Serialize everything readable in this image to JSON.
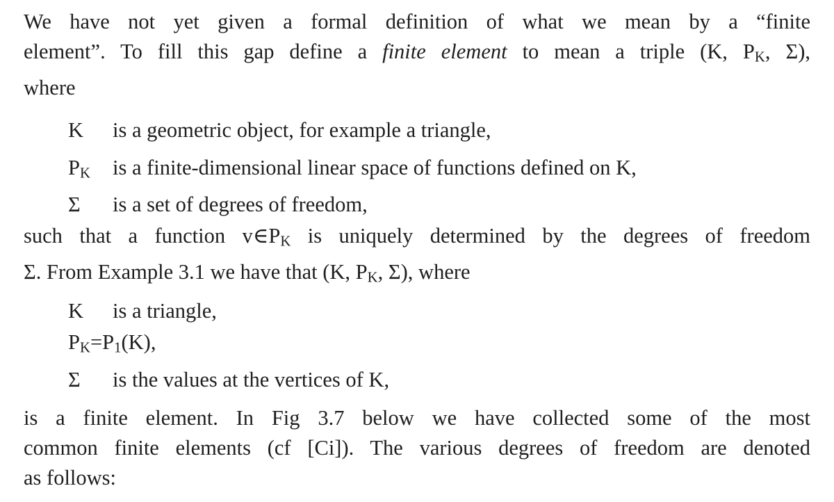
{
  "paragraph1": {
    "line1": "We have not yet given a formal definition of what we mean by a “finite",
    "line2_pre": "element”. To fill this gap define a ",
    "line2_em": "finite element",
    "line2_post": " to mean a triple (K, P",
    "line2_sub": "K",
    "line2_end": ", Σ),",
    "line3": "where"
  },
  "definition_list": [
    {
      "symbol": "K",
      "symbol_sub": "",
      "text": "is a geometric object, for example a triangle,"
    },
    {
      "symbol": "P",
      "symbol_sub": "K",
      "text": "is a finite-dimensional linear space of functions defined on K,"
    },
    {
      "symbol": "Σ",
      "symbol_sub": "",
      "text": "is a set of degrees of freedom,"
    }
  ],
  "paragraph2": {
    "line1_pre": "such that a function v∈P",
    "line1_sub": "K",
    "line1_post": " is uniquely determined by the degrees of freedom",
    "line2_pre": "Σ. From Example 3.1 we have that (K, P",
    "line2_sub": "K",
    "line2_post": ", Σ), where"
  },
  "example_list": {
    "item1_symbol": "K",
    "item1_text": "is a triangle,",
    "item2_a": "P",
    "item2_sub1": "K",
    "item2_b": "=P",
    "item2_sub2": "1",
    "item2_c": "(K),",
    "item3_symbol": "Σ",
    "item3_text": "is the values at the vertices of K,"
  },
  "paragraph3": {
    "line1": "is a finite element. In Fig 3.7 below we have collected some of the most",
    "line2": "common finite elements (cf [Ci]). The various degrees of freedom are denoted",
    "line3": "as follows:"
  }
}
